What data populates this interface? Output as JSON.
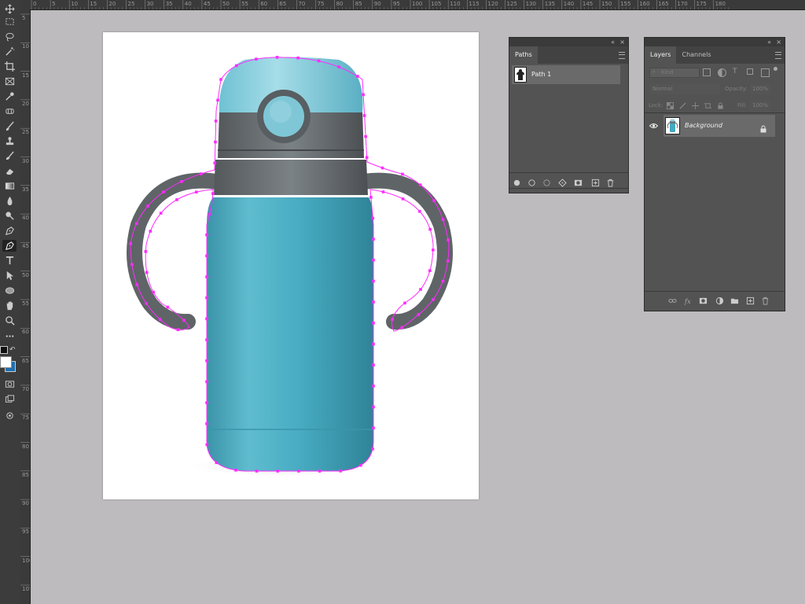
{
  "ruler": {
    "top_labels": [
      "0",
      "5",
      "10",
      "15",
      "20",
      "25",
      "30",
      "35",
      "40",
      "45",
      "50",
      "55",
      "60",
      "65",
      "70",
      "75",
      "80",
      "85",
      "90",
      "95",
      "100",
      "105",
      "110",
      "115",
      "120",
      "125",
      "130",
      "135",
      "140",
      "145",
      "150",
      "155",
      "160",
      "165",
      "170",
      "175",
      "180"
    ],
    "left_labels": [
      "5",
      "10",
      "15",
      "20",
      "25",
      "30",
      "35",
      "40",
      "45",
      "50",
      "55",
      "60",
      "65",
      "70",
      "75",
      "80",
      "85",
      "90",
      "95",
      "100",
      "105"
    ]
  },
  "paths_panel": {
    "tab": "Paths",
    "items": [
      {
        "label": "Path 1"
      }
    ],
    "collapse_icon": "double-chevron-left-icon",
    "close_icon": "close-icon",
    "buttons": [
      "fill-path-icon",
      "stroke-path-icon",
      "load-selection-icon",
      "make-work-path-icon",
      "add-mask-icon",
      "new-path-icon",
      "delete-icon"
    ]
  },
  "layers_panel": {
    "tabs": [
      "Layers",
      "Channels"
    ],
    "filter_placeholder": "Kind",
    "blend_mode": "Normal",
    "opacity_label": "Opacity:",
    "opacity_value": "100%",
    "lock_label": "Lock:",
    "fill_label": "Fill:",
    "fill_value": "100%",
    "layers": [
      {
        "name": "Background",
        "visible": true,
        "locked": true
      }
    ],
    "buttons": [
      "link-icon",
      "fx-icon",
      "mask-icon",
      "adjustment-icon",
      "group-icon",
      "new-layer-icon",
      "delete-icon"
    ]
  },
  "colors": {
    "workspace": "#bdbbbd",
    "panel": "#535353",
    "path_anchor": "#ff2bff",
    "bottle_body": "#45a9c0",
    "bottle_cap": "#6a7276"
  }
}
